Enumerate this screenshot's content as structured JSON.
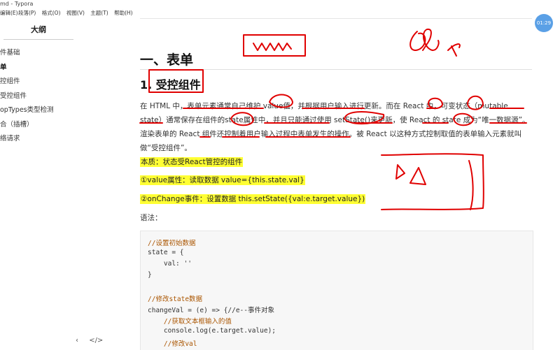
{
  "window": {
    "title": "md - Typora"
  },
  "menu": [
    "编辑(E)",
    "段落(P)",
    "格式(O)",
    "视图(V)",
    "主题(T)",
    "帮助(H)"
  ],
  "timer": "01:29",
  "outline": {
    "title": "大纲",
    "items": [
      {
        "label": "件基础",
        "active": false
      },
      {
        "label": "单",
        "active": true
      },
      {
        "label": "控组件",
        "active": false
      },
      {
        "label": "受控组件",
        "active": false
      },
      {
        "label": "opTypes类型检测",
        "active": false
      },
      {
        "label": "合（插槽）",
        "active": false
      },
      {
        "label": "络请求",
        "active": false
      }
    ],
    "footer": {
      "back": "‹",
      "source": "</>"
    }
  },
  "doc": {
    "h1": "一、表单",
    "h2_num": "1.",
    "h2_text": "受控组件",
    "para": "在 HTML 中，表单元素通常自己维护 value值，并根据用户输入进行更新。而在 React 中，可变状态（mutable state）通常保存在组件的state属性中，并且只能通过使用 setState()来更新，使 React 的 state 成为“唯一数据源”。渲染表单的 React 组件还控制着用户输入过程中表单发生的操作。被 React 以这种方式控制取值的表单输入元素就叫做“受控组件”。",
    "hl1": "本质：状态受React管控的组件",
    "hl2": "①value属性：读取数据  value={this.state.val}",
    "hl3": "②onChange事件：设置数据  this.setState({val:e.target.value})",
    "syntax": "语法：",
    "code": [
      "//设置初始数据",
      "state = {",
      "    val: ''",
      "}",
      "",
      "//修改state数据",
      "changeVal = (e) => {//e--事件对象",
      "    //获取文本框输入的值",
      "    console.log(e.target.value);",
      "    //修改val"
    ]
  }
}
